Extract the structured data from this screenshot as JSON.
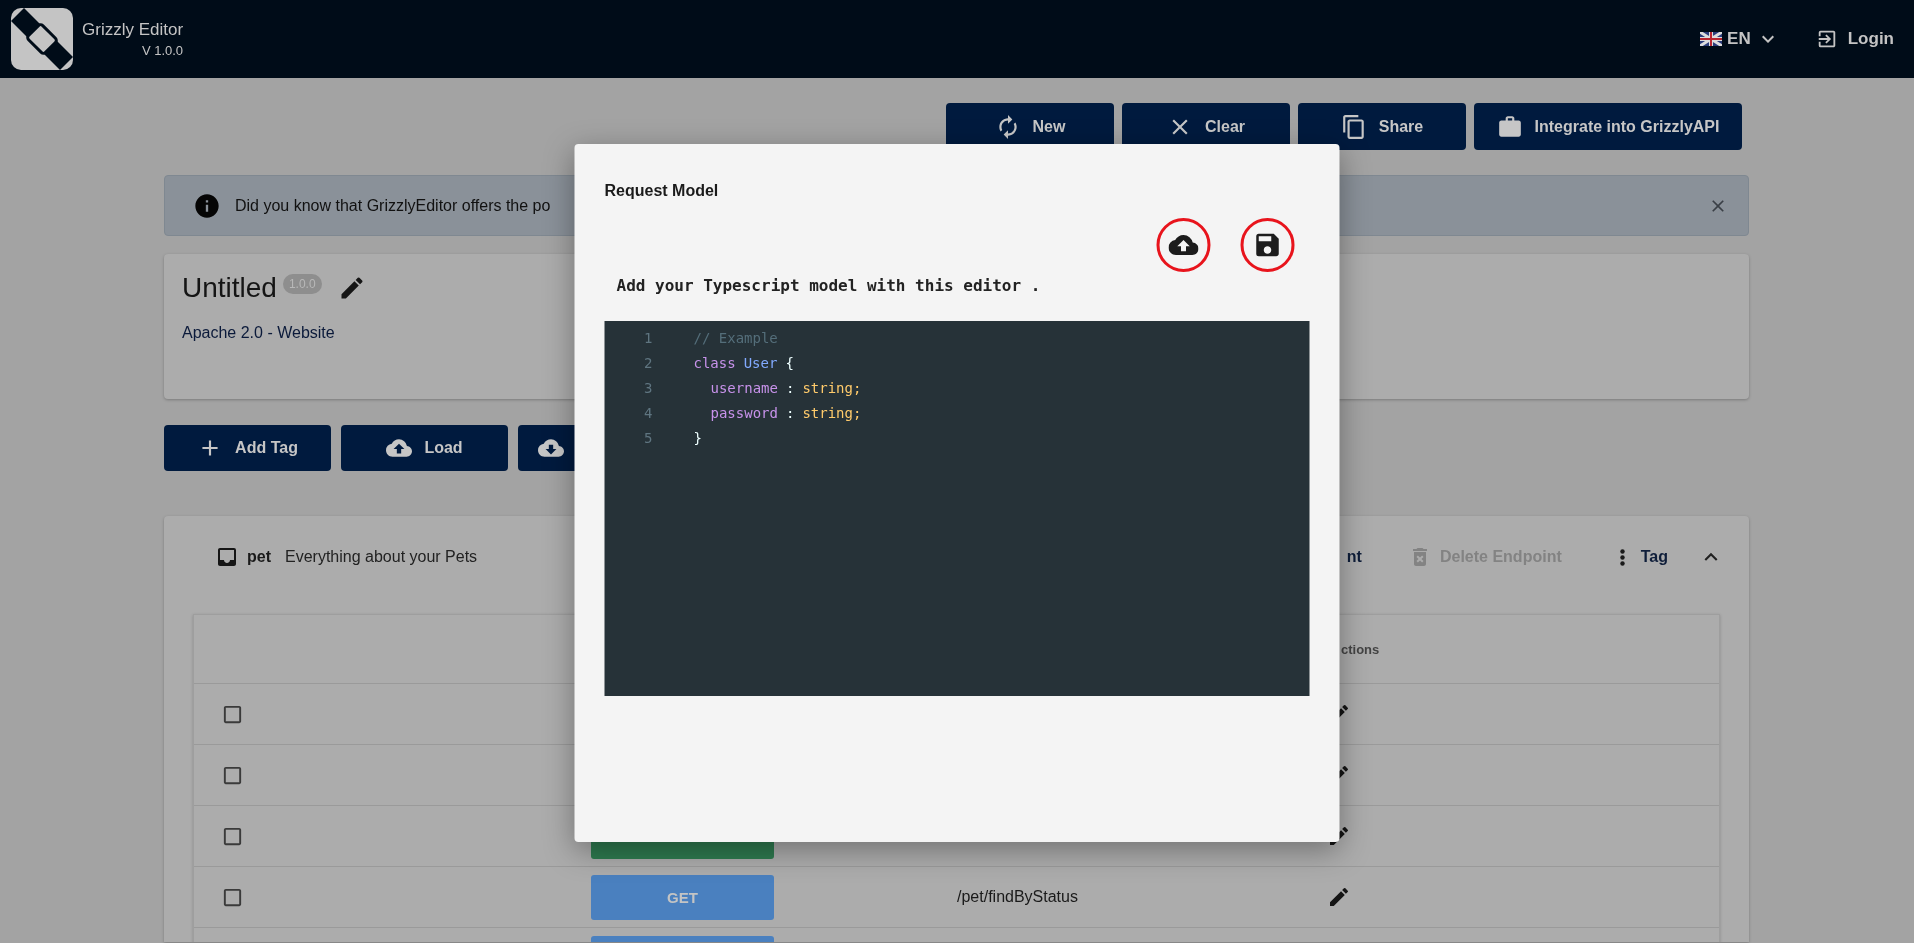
{
  "header": {
    "app_name": "Grizzly Editor",
    "version": "V 1.0.0",
    "language": "EN",
    "login": "Login"
  },
  "actions": [
    {
      "kind": "new",
      "label": "New"
    },
    {
      "kind": "clear",
      "label": "Clear"
    },
    {
      "kind": "share",
      "label": "Share"
    },
    {
      "kind": "integrate",
      "label": "Integrate into GrizzlyAPI"
    }
  ],
  "banner": {
    "text": "Did you know that GrizzlyEditor offers the po"
  },
  "project": {
    "title": "Untitled",
    "version": "1.0.0",
    "license": "Apache 2.0 - Website"
  },
  "toolbar": [
    {
      "kind": "add",
      "label": "Add Tag"
    },
    {
      "kind": "load",
      "label": "Load"
    },
    {
      "kind": "download"
    }
  ],
  "tag": {
    "name": "pet",
    "description": "Everything about your Pets",
    "expanded": true,
    "actions": [
      {
        "kind": "partial",
        "label": "nt"
      },
      {
        "kind": "delete",
        "label": "Delete Endpoint",
        "disabled": true
      },
      {
        "kind": "menu",
        "label": "Tag",
        "disabled": false
      }
    ]
  },
  "table": {
    "column_4": "ctions",
    "rows": [
      {
        "checked": false
      },
      {
        "checked": false
      },
      {
        "checked": false,
        "color": "#2e7a4f"
      },
      {
        "checked": false,
        "color": "#4a80bf",
        "method": "GET",
        "path": "/pet/findByStatus"
      },
      {
        "color": "#4a80bf"
      }
    ]
  },
  "modal": {
    "title": "Request Model",
    "tools": [
      {
        "kind": "upload",
        "highlighted": true
      },
      {
        "kind": "save",
        "highlighted": true
      }
    ],
    "hint": "Add your Typescript model with this editor .",
    "code": [
      {
        "number": "1",
        "tokens": [
          {
            "kind": "comment",
            "text": "// Example"
          }
        ]
      },
      {
        "number": "2",
        "tokens": [
          {
            "kind": "keyword",
            "text": "class"
          },
          {
            "kind": "class",
            "text": "User"
          },
          {
            "kind": "punct",
            "text": "{"
          }
        ]
      },
      {
        "number": "3",
        "tokens": [
          {
            "kind": "property",
            "text": "username"
          },
          {
            "kind": "punct",
            "text": ":"
          },
          {
            "kind": "type",
            "text": "string;"
          }
        ]
      },
      {
        "number": "4",
        "tokens": [
          {
            "kind": "property",
            "text": "password"
          },
          {
            "kind": "punct",
            "text": ":"
          },
          {
            "kind": "type",
            "text": "string;"
          }
        ]
      },
      {
        "number": "5",
        "tokens": [
          {
            "kind": "punct",
            "text": "}"
          }
        ]
      }
    ]
  }
}
